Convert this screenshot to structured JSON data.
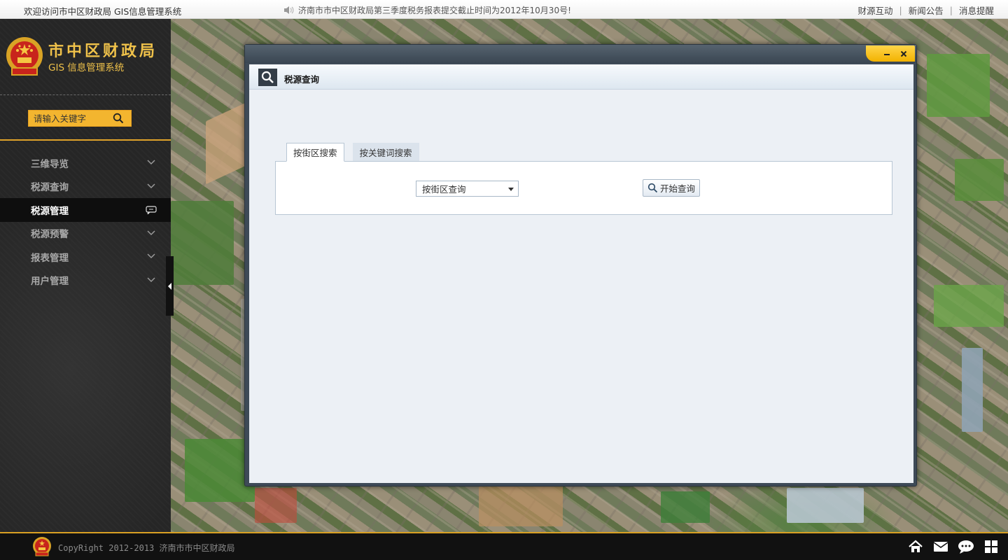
{
  "topbar": {
    "welcome": "欢迎访问市中区财政局 GIS信息管理系统",
    "notice": "济南市市中区财政局第三季度税务报表提交截止时间为2012年10月30号!",
    "links": [
      "财源互动",
      "新闻公告",
      "消息提醒"
    ]
  },
  "sidebar": {
    "logo_title": "市中区财政局",
    "logo_subtitle": "GIS 信息管理系统",
    "search_placeholder": "请输入关键字",
    "menu": [
      {
        "label": "三维导览",
        "icon": "chevron-down-icon"
      },
      {
        "label": "税源查询",
        "icon": "chevron-down-icon"
      },
      {
        "label": "税源管理",
        "icon": "chat-bubble-icon",
        "active": true
      },
      {
        "label": "税源预警",
        "icon": "chevron-down-icon"
      },
      {
        "label": "报表管理",
        "icon": "chevron-down-icon"
      },
      {
        "label": "用户管理",
        "icon": "chevron-down-icon"
      }
    ]
  },
  "window": {
    "title": "税源查询",
    "tabs": [
      "按街区搜索",
      "按关键词搜索"
    ],
    "active_tab": 0,
    "select_value": "按街区查询",
    "query_button": "开始查询"
  },
  "footer": {
    "copyright": "CopyRight 2012-2013 济南市市中区财政局",
    "icons": [
      "home-icon",
      "mail-icon",
      "chat-icon",
      "grid-icon"
    ]
  },
  "colors": {
    "accent_gold": "#f0c24a",
    "search_bg": "#f3b52f",
    "window_frame": "#3e4a57",
    "panel_bg": "#ecf0f5"
  }
}
